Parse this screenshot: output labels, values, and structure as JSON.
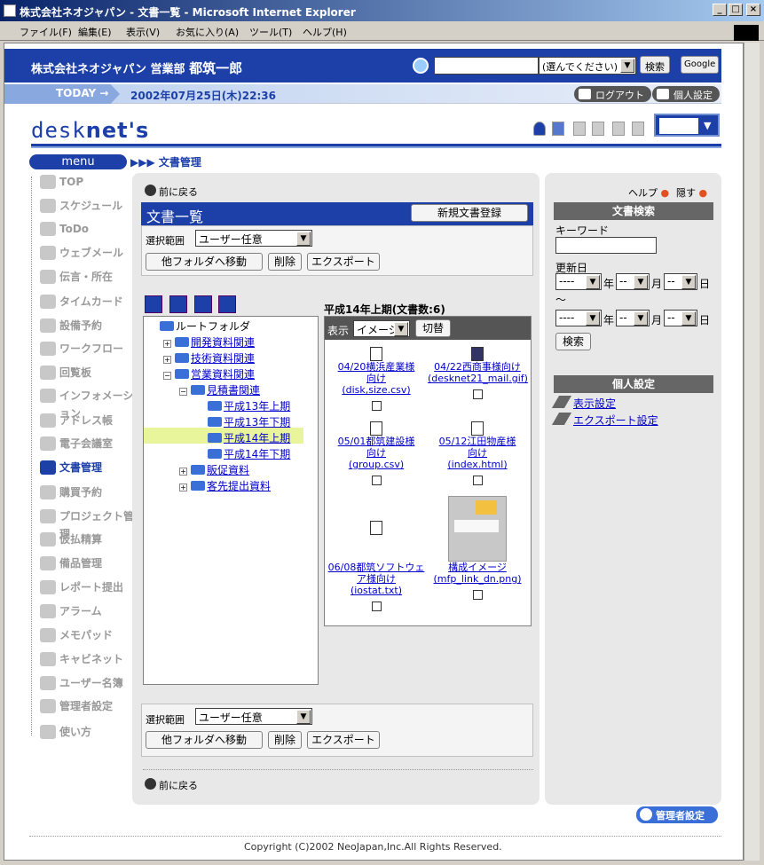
{
  "window": {
    "title": "株式会社ネオジャパン - 文書一覧 - Microsoft Internet Explorer",
    "min": "_",
    "max": "□",
    "close": "×"
  },
  "ie_menu": [
    "ファイル(F)",
    "編集(E)",
    "表示(V)",
    "お気に入り(A)",
    "ツール(T)",
    "ヘルプ(H)"
  ],
  "header": {
    "company": "株式会社ネオジャパン 営業部",
    "user": "都筑一郎",
    "search_select": "(選んでください)",
    "search_btn": "検索",
    "google_btn": "Google"
  },
  "today": {
    "label": "TODAY",
    "datetime": "2002年07月25日(木)22:36",
    "logout": "ログアウト",
    "personal": "個人設定"
  },
  "logo": {
    "a": "desk",
    "b": "net's"
  },
  "menu": {
    "title": "menu",
    "breadcrumb": "▶▶▶ 文書管理",
    "items": [
      "TOP",
      "スケジュール",
      "ToDo",
      "ウェブメール",
      "伝言・所在",
      "タイムカード",
      "設備予約",
      "ワークフロー",
      "回覧板",
      "インフォメーション",
      "アドレス帳",
      "電子会議室",
      "文書管理",
      "購買予約",
      "プロジェクト管理",
      "仮払精算",
      "備品管理",
      "レポート提出",
      "アラーム",
      "メモパッド",
      "キャビネット",
      "ユーザー名簿",
      "管理者設定",
      "使い方"
    ]
  },
  "main": {
    "back": "前に戻る",
    "title": "文書一覧",
    "new_btn": "新規文書登録",
    "scope_label": "選択範囲",
    "scope_value": "ユーザー任意",
    "move_btn": "他フォルダへ移動",
    "delete_btn": "削除",
    "export_btn": "エクスポート"
  },
  "tree": {
    "root": "ルートフォルダ",
    "n1": "開発資料関連",
    "n2": "技術資料関連",
    "n3": "営業資料関連",
    "n4": "見積書関連",
    "n5": "平成13年上期",
    "n6": "平成13年下期",
    "n7": "平成14年上期",
    "n8": "平成14年下期",
    "n9": "販促資料",
    "n10": "客先提出資料"
  },
  "docs": {
    "heading": "平成14年上期(文書数:6)",
    "view_label": "表示",
    "view_value": "イメージ",
    "switch_btn": "切替",
    "items": [
      {
        "t1": "04/20横浜産業様",
        "t2": "向け",
        "f": "(disk,size.csv)",
        "icon": "csv-file-icon"
      },
      {
        "t1": "04/22西商事様向け",
        "t2": "",
        "f": "(desknet21_mail.gif)",
        "icon": "gif-file-icon"
      },
      {
        "t1": "05/01都筑建設様",
        "t2": "向け",
        "f": "(group.csv)",
        "icon": "csv-file-icon"
      },
      {
        "t1": "05/12江田物産様",
        "t2": "向け",
        "f": "(index.html)",
        "icon": "html-file-icon"
      },
      {
        "t1": "06/08都筑ソフトウェ",
        "t2": "ア様向け",
        "f": "(iostat.txt)",
        "icon": "txt-file-icon"
      },
      {
        "t1": "構成イメージ",
        "t2": "",
        "f": "(mfp_link_dn.png)",
        "icon": "image-thumbnail"
      }
    ]
  },
  "right": {
    "help": "ヘルプ",
    "hide": "隠す",
    "search_title": "文書検索",
    "keyword": "キーワード",
    "date": "更新日",
    "tilde": "～",
    "year": "年",
    "month": "月",
    "day": "日",
    "dash": "----",
    "dd": "--",
    "search_btn": "検索",
    "pers_title": "個人設定",
    "disp_link": "表示設定",
    "exp_link": "エクスポート設定"
  },
  "footer": {
    "admin": "管理者設定",
    "copyright": "Copyright (C)2002 NeoJapan,Inc.All Rights Reserved."
  }
}
